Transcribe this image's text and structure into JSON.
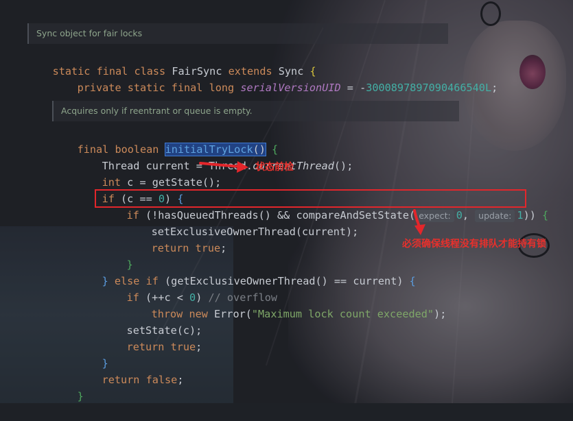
{
  "editor": {
    "doc_comment_1": "Sync object for fair locks",
    "doc_comment_2": "Acquires only if reentrant or queue is empty.",
    "lines": {
      "l1": {
        "kw1": "static final class ",
        "name": "FairSync ",
        "kw2": "extends ",
        "parent": "Sync ",
        "brace": "{"
      },
      "l2": {
        "kw": "private static final long ",
        "field": "serialVersionUID",
        "eq": " = -",
        "num": "3000897897090466540L",
        "semi": ";"
      },
      "l3": {
        "kw": "final boolean ",
        "method": "initialTryLock",
        "parens": "()",
        "brace": " {"
      },
      "l4": {
        "a": "Thread current = Thread.",
        "b": "currentThread",
        "c": "();"
      },
      "l5": {
        "kw": "int ",
        "a": "c = getState();"
      },
      "l6": {
        "kw": "if ",
        "a": "(c == ",
        "num": "0",
        "b": ") ",
        "brace": "{"
      },
      "l7": {
        "kw": "if ",
        "a": "(!hasQueuedThreads() && compareAndSetState(",
        "hint1": "expect:",
        "n1": "0",
        "comma": ", ",
        "hint2": "update:",
        "n2": "1",
        "b": ")) ",
        "brace": "{"
      },
      "l8": {
        "a": "setExclusiveOwnerThread(current);"
      },
      "l9": {
        "kw": "return true",
        "a": ";"
      },
      "l10": {
        "brace": "}"
      },
      "l11": {
        "a": "} ",
        "kw": "else if ",
        "b": "(getExclusiveOwnerThread() == current) ",
        "brace": "{"
      },
      "l12": {
        "kw": "if ",
        "a": "(++c < ",
        "num": "0",
        "b": ") ",
        "cm": "// overflow"
      },
      "l13": {
        "kw": "throw new ",
        "a": "Error(",
        "str": "\"Maximum lock count exceeded\"",
        "b": ");"
      },
      "l14": {
        "a": "setState(c);"
      },
      "l15": {
        "kw": "return true",
        "a": ";"
      },
      "l16": {
        "a": "}"
      },
      "l17": {
        "kw": "return false",
        "a": ";"
      },
      "l18": {
        "brace": "}"
      }
    }
  },
  "annotations": {
    "state_precheck": "状态前检",
    "must_ensure": "必须确保线程没有排队才能持有锁"
  },
  "colors": {
    "annotation_red": "#e3262b",
    "keyword": "#cc8a5a",
    "method": "#5fa3e0",
    "number": "#43b0a6",
    "string": "#7fa768"
  }
}
